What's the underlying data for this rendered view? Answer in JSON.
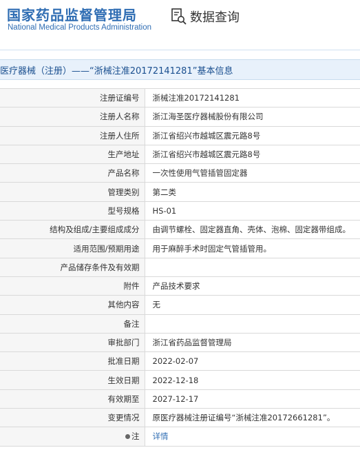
{
  "header": {
    "brand_cn": "国家药品监督管理局",
    "brand_en": "National Medical Products Administration",
    "query_label": "数据查询"
  },
  "title_bar": "医疗器械（注册）——“浙械注准20172141281”基本信息",
  "rows": [
    {
      "label": "注册证编号",
      "value": "浙械注准20172141281"
    },
    {
      "label": "注册人名称",
      "value": "浙江海圣医疗器械股份有限公司"
    },
    {
      "label": "注册人住所",
      "value": "浙江省绍兴市越城区震元路8号"
    },
    {
      "label": "生产地址",
      "value": "浙江省绍兴市越城区震元路8号"
    },
    {
      "label": "产品名称",
      "value": "一次性使用气管插管固定器"
    },
    {
      "label": "管理类别",
      "value": "第二类"
    },
    {
      "label": "型号规格",
      "value": "HS-01"
    },
    {
      "label": "结构及组成/主要组成成分",
      "value": "由调节螺栓、固定器直角、壳体、泡棉、固定器带组成。"
    },
    {
      "label": "适用范围/预期用途",
      "value": "用于麻醉手术时固定气管插管用。"
    },
    {
      "label": "产品储存条件及有效期",
      "value": ""
    },
    {
      "label": "附件",
      "value": "产品技术要求"
    },
    {
      "label": "其他内容",
      "value": "无"
    },
    {
      "label": "备注",
      "value": ""
    },
    {
      "label": "审批部门",
      "value": "浙江省药品监督管理局"
    },
    {
      "label": "批准日期",
      "value": "2022-02-07"
    },
    {
      "label": "生效日期",
      "value": "2022-12-18"
    },
    {
      "label": "有效期至",
      "value": "2027-12-17"
    },
    {
      "label": "变更情况",
      "value": "原医疗器械注册证编号“浙械注准20172661281”。"
    }
  ],
  "note": {
    "label": "注",
    "link": "详情"
  },
  "colors": {
    "brand_blue": "#2f6db3",
    "title_bg": "#e8f1fb"
  }
}
